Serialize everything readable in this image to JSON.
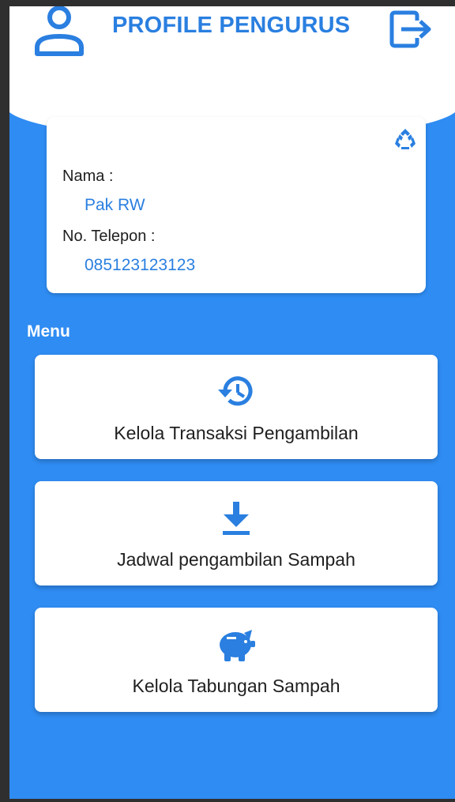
{
  "header": {
    "title": "PROFILE PENGURUS",
    "profile_icon": "person-outline-icon",
    "logout_icon": "logout-icon"
  },
  "profile_card": {
    "refresh_icon": "recycle-icon",
    "name_label": "Nama :",
    "name_value": "Pak RW",
    "phone_label": "No. Telepon :",
    "phone_value": "085123123123"
  },
  "menu": {
    "title": "Menu",
    "items": [
      {
        "label": "Kelola Transaksi Pengambilan",
        "icon": "history-icon"
      },
      {
        "label": "Jadwal pengambilan Sampah",
        "icon": "download-icon"
      },
      {
        "label": "Kelola Tabungan Sampah",
        "icon": "piggy-bank-icon"
      }
    ]
  },
  "colors": {
    "accent": "#2a7fe0",
    "background": "#2f8cf2",
    "card": "#ffffff",
    "text": "#1f1f1f"
  }
}
